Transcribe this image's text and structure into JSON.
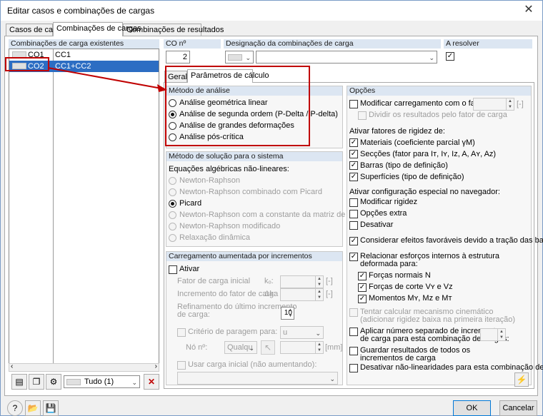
{
  "window": {
    "title": "Editar casos e combinações de cargas",
    "close_glyph": "✕"
  },
  "tabs": [
    "Casos de carga",
    "Combinações de cargas",
    "Combinações de resultados"
  ],
  "existing": {
    "header": "Combinações de carga existentes",
    "rows": [
      {
        "id": "CO1",
        "desc": "CC1",
        "selected": false
      },
      {
        "id": "CO2",
        "desc": "CC1+CC2",
        "selected": true
      }
    ],
    "filter_value": "Tudo (1)"
  },
  "co_no": {
    "header": "CO nº",
    "value": "2"
  },
  "designation": {
    "header": "Designação da combinações de carga",
    "value": ""
  },
  "resolve": {
    "header": "A resolver",
    "checked": true
  },
  "inner_tabs": [
    "Geral",
    "Parâmetros de cálculo"
  ],
  "analysis": {
    "header": "Método de análise",
    "options": [
      "Análise geométrica linear",
      "Análise de segunda ordem (P-Delta / P-delta)",
      "Análise de grandes deformações",
      "Análise pós-crítica"
    ],
    "selected_index": 1
  },
  "solver": {
    "header": "Método de solução para o sistema",
    "subheader": "Equações algébricas não-lineares:",
    "options": [
      "Newton-Raphson",
      "Newton-Raphson combinado com Picard",
      "Picard",
      "Newton-Raphson com a constante da matriz de rigidez",
      "Newton-Raphson modificado",
      "Relaxação dinâmica"
    ],
    "selected_index": 2
  },
  "incremental": {
    "header": "Carregamento aumentada por incrementos",
    "activate_label": "Ativar",
    "initial_factor_label": "Fator de carga inicial",
    "initial_factor_sym": "kₒ:",
    "increment_label": "Incremento do fator de carga",
    "increment_sym": "Δk:",
    "refine_label_1": "Refinamento do último incremento",
    "refine_label_2": "de carga:",
    "refine_value": "10",
    "stop_label": "Critério de paragem para:",
    "stop_value": "u",
    "node_label": "Nó nº:",
    "node_value": "Qualqu",
    "unit_empty": "[-]",
    "unit_mm": "[mm]",
    "use_initial_label": "Usar carga inicial (não aumentando):"
  },
  "options": {
    "header": "Opções",
    "modify_label": "Modificar carregamento com o fator:",
    "modify_unit": "[-]",
    "divide_label": "Dividir os resultados pelo fator de carga",
    "stiffness_header": "Ativar fatores de rigidez de:",
    "stiffness": [
      {
        "label": "Materiais (coeficiente parcial γM)",
        "checked": true
      },
      {
        "label": "Secções (fator para Iᴛ, Iʏ, Iᴢ, A, Aʏ, Aᴢ)",
        "checked": true
      },
      {
        "label": "Barras (tipo de definição)",
        "checked": true
      },
      {
        "label": "Superfícies (tipo de definição)",
        "checked": true
      }
    ],
    "nav_header": "Ativar configuração especial no navegador:",
    "nav": [
      {
        "label": "Modificar rigidez",
        "checked": false
      },
      {
        "label": "Opções extra",
        "checked": false
      },
      {
        "label": "Desativar",
        "checked": false
      }
    ],
    "favorable_label": "Considerar efeitos favoráveis devido a tração das barras",
    "relate_label_1": "Relacionar esforços internos à estrutura",
    "relate_label_2": "deformada para:",
    "relate": [
      {
        "label": "Forças normais N",
        "checked": true
      },
      {
        "label": "Forças de corte Vʏ e Vᴢ",
        "checked": true
      },
      {
        "label": "Momentos Mʏ, Mᴢ e Mᴛ",
        "checked": true
      }
    ],
    "kinematic_label_1": "Tentar calcular mecanismo cinemático",
    "kinematic_label_2": "(adicionar rigidez baixa na primeira iteração)",
    "separate_label_1": "Aplicar número separado de incrementos",
    "separate_label_2": "de carga para esta combinação de cargas:",
    "save_label_1": "Guardar resultados de todos os",
    "save_label_2": "incrementos de carga",
    "deactivate_label": "Desativar não-linearidades para esta combinação de cargas"
  },
  "footer": {
    "ok": "OK",
    "cancel": "Cancelar"
  },
  "colors": {
    "selection": "#2c6dc3",
    "group_header": "#dce6f2",
    "annotation": "#c00000"
  }
}
